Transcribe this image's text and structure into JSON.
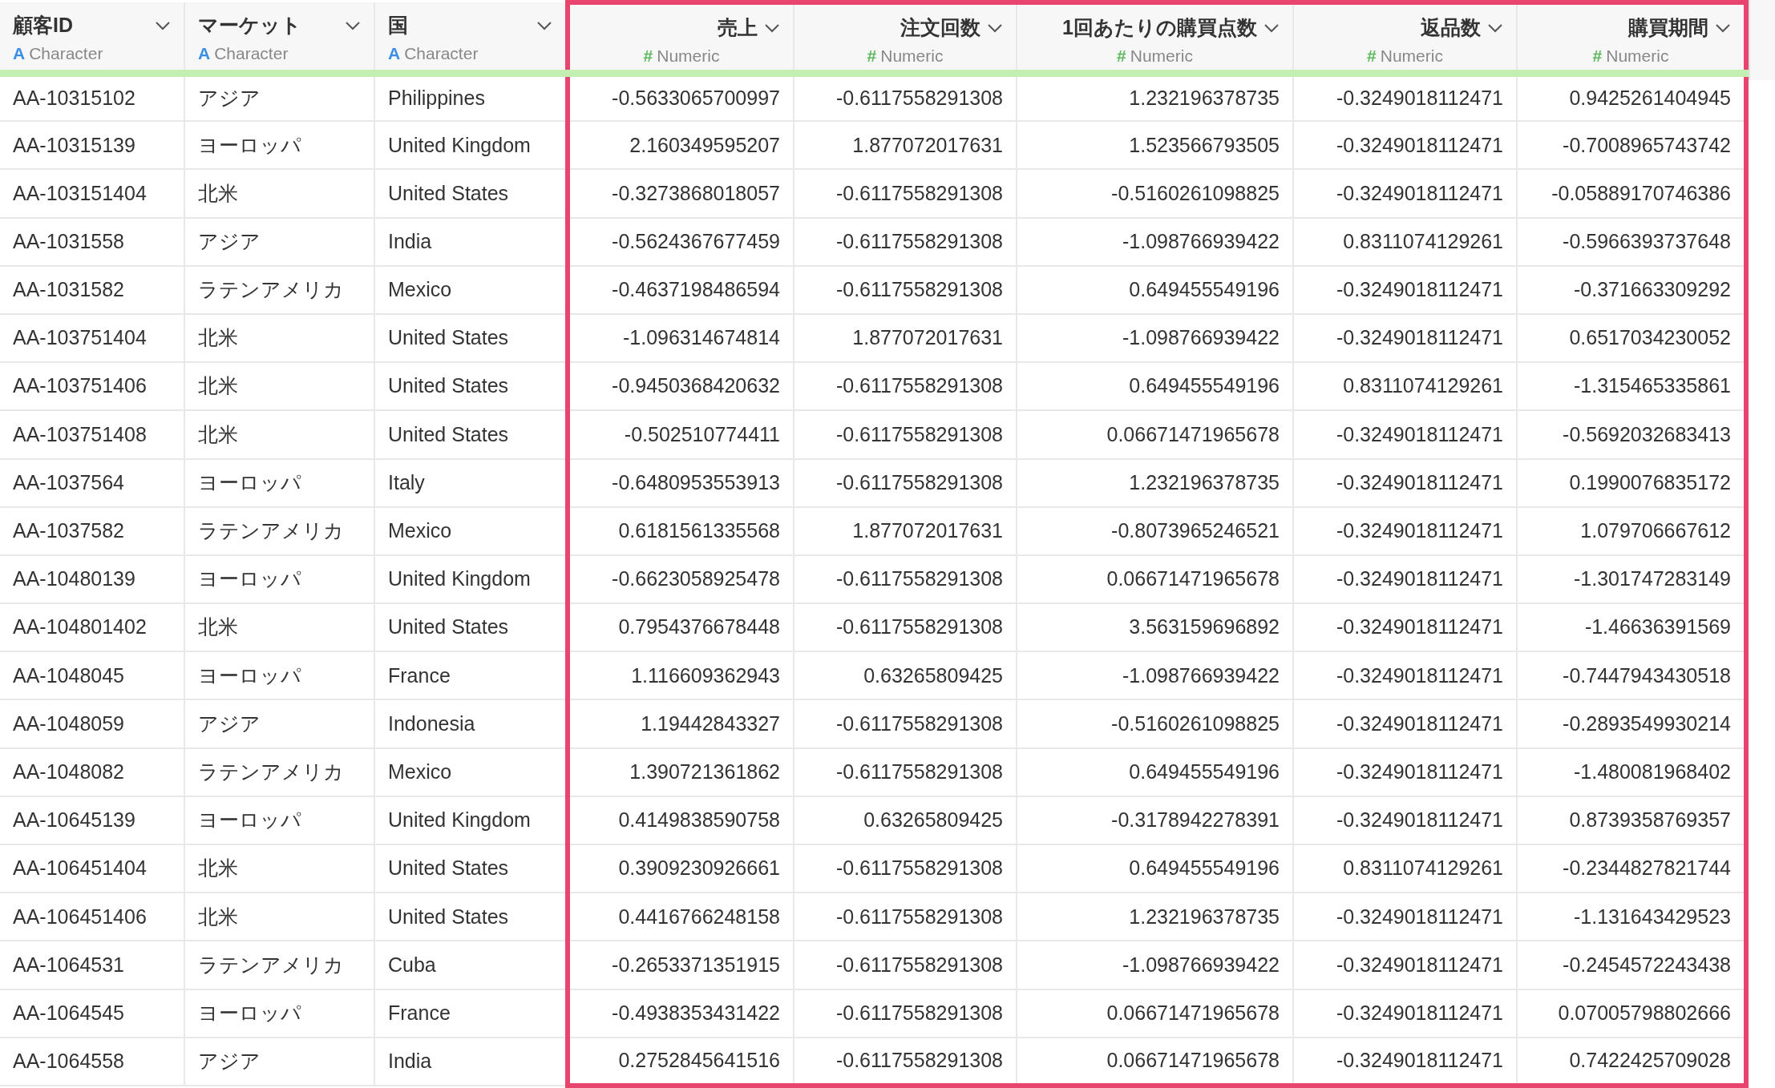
{
  "table": {
    "columns": [
      {
        "name": "顧客ID",
        "type_icon": "A",
        "type": "Character",
        "selected": false
      },
      {
        "name": "マーケット",
        "type_icon": "A",
        "type": "Character",
        "selected": false
      },
      {
        "name": "国",
        "type_icon": "A",
        "type": "Character",
        "selected": false
      },
      {
        "name": "売上",
        "type_icon": "#",
        "type": "Numeric",
        "selected": true
      },
      {
        "name": "注文回数",
        "type_icon": "#",
        "type": "Numeric",
        "selected": true
      },
      {
        "name": "1回あたりの購買点数",
        "type_icon": "#",
        "type": "Numeric",
        "selected": true
      },
      {
        "name": "返品数",
        "type_icon": "#",
        "type": "Numeric",
        "selected": true
      },
      {
        "name": "購買期間",
        "type_icon": "#",
        "type": "Numeric",
        "selected": true
      }
    ],
    "rows": [
      [
        "AA-10315102",
        "アジア",
        "Philippines",
        "-0.5633065700997",
        "-0.6117558291308",
        "1.232196378735",
        "-0.3249018112471",
        "0.9425261404945"
      ],
      [
        "AA-10315139",
        "ヨーロッパ",
        "United Kingdom",
        "2.160349595207",
        "1.877072017631",
        "1.523566793505",
        "-0.3249018112471",
        "-0.7008965743742"
      ],
      [
        "AA-103151404",
        "北米",
        "United States",
        "-0.3273868018057",
        "-0.6117558291308",
        "-0.5160261098825",
        "-0.3249018112471",
        "-0.05889170746386"
      ],
      [
        "AA-1031558",
        "アジア",
        "India",
        "-0.5624367677459",
        "-0.6117558291308",
        "-1.098766939422",
        "0.8311074129261",
        "-0.5966393737648"
      ],
      [
        "AA-1031582",
        "ラテンアメリカ",
        "Mexico",
        "-0.4637198486594",
        "-0.6117558291308",
        "0.649455549196",
        "-0.3249018112471",
        "-0.371663309292"
      ],
      [
        "AA-103751404",
        "北米",
        "United States",
        "-1.096314674814",
        "1.877072017631",
        "-1.098766939422",
        "-0.3249018112471",
        "0.6517034230052"
      ],
      [
        "AA-103751406",
        "北米",
        "United States",
        "-0.9450368420632",
        "-0.6117558291308",
        "0.649455549196",
        "0.8311074129261",
        "-1.315465335861"
      ],
      [
        "AA-103751408",
        "北米",
        "United States",
        "-0.502510774411",
        "-0.6117558291308",
        "0.06671471965678",
        "-0.3249018112471",
        "-0.5692032683413"
      ],
      [
        "AA-1037564",
        "ヨーロッパ",
        "Italy",
        "-0.6480953553913",
        "-0.6117558291308",
        "1.232196378735",
        "-0.3249018112471",
        "0.1990076835172"
      ],
      [
        "AA-1037582",
        "ラテンアメリカ",
        "Mexico",
        "0.6181561335568",
        "1.877072017631",
        "-0.8073965246521",
        "-0.3249018112471",
        "1.079706667612"
      ],
      [
        "AA-10480139",
        "ヨーロッパ",
        "United Kingdom",
        "-0.6623058925478",
        "-0.6117558291308",
        "0.06671471965678",
        "-0.3249018112471",
        "-1.301747283149"
      ],
      [
        "AA-104801402",
        "北米",
        "United States",
        "0.7954376678448",
        "-0.6117558291308",
        "3.563159696892",
        "-0.3249018112471",
        "-1.46636391569"
      ],
      [
        "AA-1048045",
        "ヨーロッパ",
        "France",
        "1.116609362943",
        "0.63265809425",
        "-1.098766939422",
        "-0.3249018112471",
        "-0.7447943430518"
      ],
      [
        "AA-1048059",
        "アジア",
        "Indonesia",
        "1.19442843327",
        "-0.6117558291308",
        "-0.5160261098825",
        "-0.3249018112471",
        "-0.2893549930214"
      ],
      [
        "AA-1048082",
        "ラテンアメリカ",
        "Mexico",
        "1.390721361862",
        "-0.6117558291308",
        "0.649455549196",
        "-0.3249018112471",
        "-1.480081968402"
      ],
      [
        "AA-10645139",
        "ヨーロッパ",
        "United Kingdom",
        "0.4149838590758",
        "0.63265809425",
        "-0.3178942278391",
        "-0.3249018112471",
        "0.8739358769357"
      ],
      [
        "AA-106451404",
        "北米",
        "United States",
        "0.3909230926661",
        "-0.6117558291308",
        "0.649455549196",
        "0.8311074129261",
        "-0.2344827821744"
      ],
      [
        "AA-106451406",
        "北米",
        "United States",
        "0.4416766248158",
        "-0.6117558291308",
        "1.232196378735",
        "-0.3249018112471",
        "-1.131643429523"
      ],
      [
        "AA-1064531",
        "ラテンアメリカ",
        "Cuba",
        "-0.2653371351915",
        "-0.6117558291308",
        "-1.098766939422",
        "-0.3249018112471",
        "-0.2454572243438"
      ],
      [
        "AA-1064545",
        "ヨーロッパ",
        "France",
        "-0.4938353431422",
        "-0.6117558291308",
        "0.06671471965678",
        "-0.3249018112471",
        "0.07005798802666"
      ],
      [
        "AA-1064558",
        "アジア",
        "India",
        "0.2752845641516",
        "-0.6117558291308",
        "0.06671471965678",
        "-0.3249018112471",
        "0.7422425709028"
      ]
    ]
  }
}
